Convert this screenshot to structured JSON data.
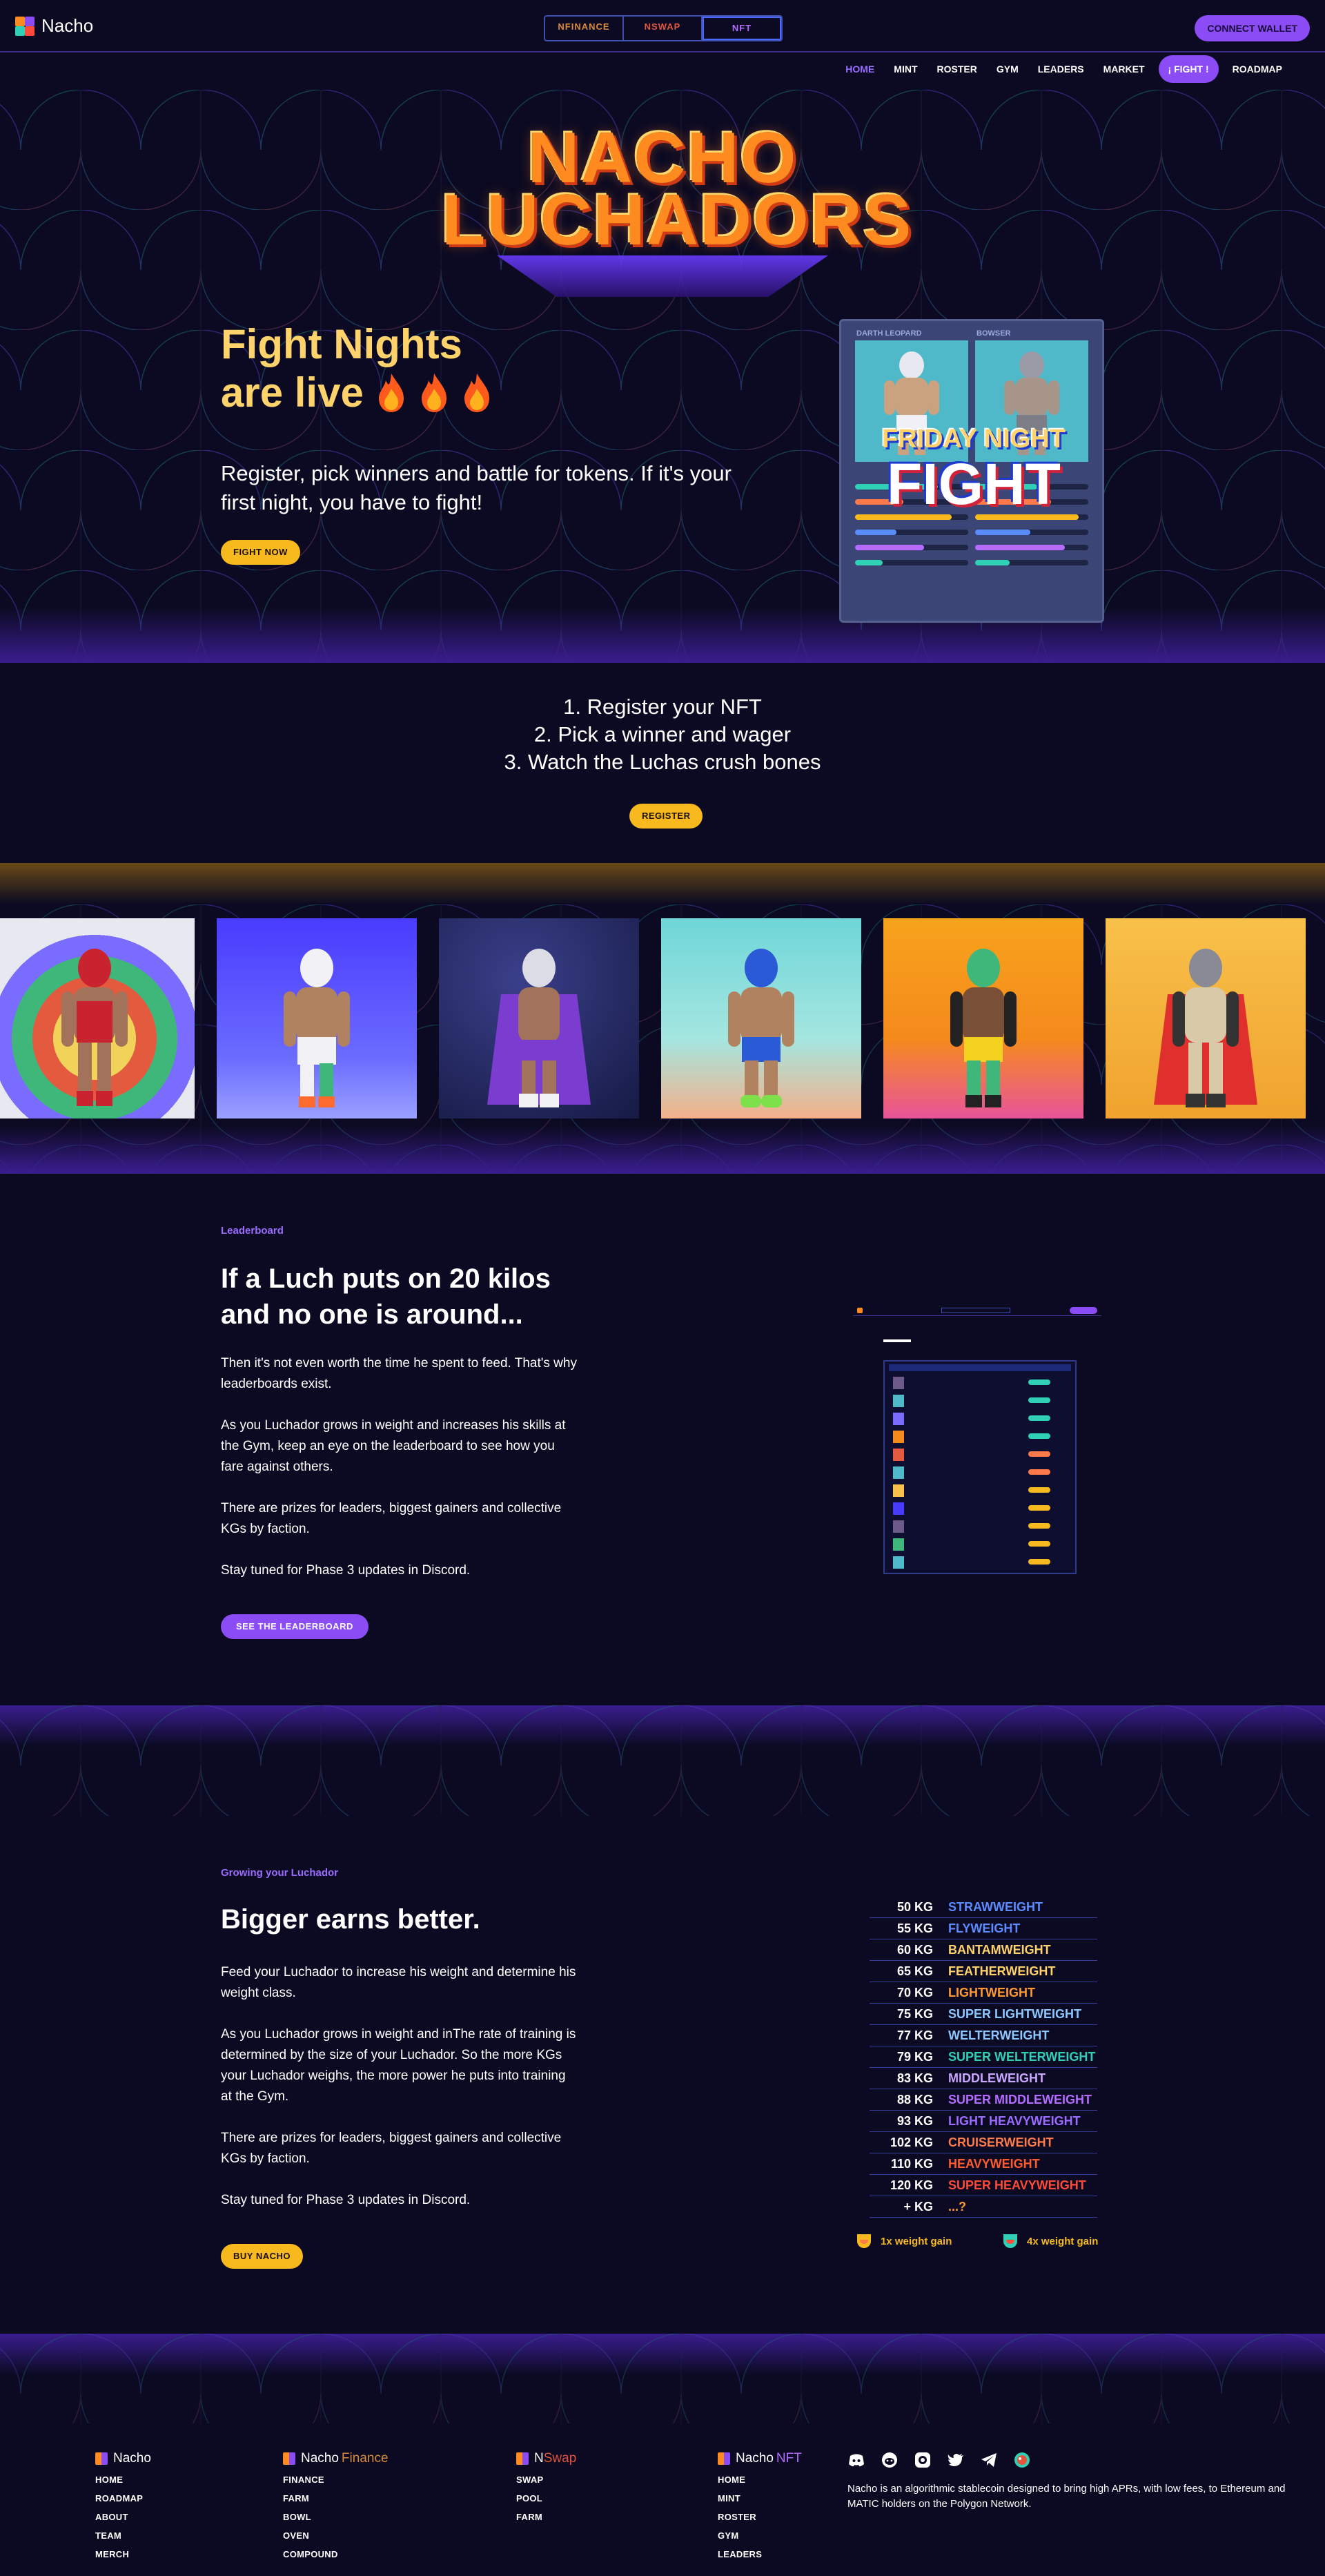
{
  "brand": {
    "name": "Nacho"
  },
  "product_switch": {
    "finance": "NFINANCE",
    "swap": "NSWAP",
    "nft": "NFT"
  },
  "connect_label": "CONNECT WALLET",
  "nav": {
    "items": [
      "HOME",
      "MINT",
      "ROSTER",
      "GYM",
      "LEADERS",
      "MARKET",
      "¡ FIGHT !",
      "ROADMAP"
    ],
    "active": "HOME"
  },
  "hero": {
    "title_line1": "NACHO",
    "title_line2": "LUCHADORS",
    "heading_line1": "Fight Nights",
    "heading_line2": "are live",
    "subtitle": "Register, pick winners and battle for tokens. If it's your first night, you have to fight!",
    "cta": "FIGHT NOW"
  },
  "fight_card": {
    "left_name": "DARTH LEOPARD",
    "right_name": "BOWSER",
    "banner_line1": "FRIDAY NIGHT",
    "banner_line2": "FIGHT"
  },
  "steps": {
    "items": [
      "1. Register your NFT",
      "2. Pick a winner and wager",
      "3. Watch the Luchas crush bones"
    ],
    "cta": "REGISTER"
  },
  "leaderboard": {
    "eyebrow": "Leaderboard",
    "heading_line1": "If a Luch puts on 20 kilos",
    "heading_line2": "and no one is around...",
    "paragraphs": [
      "Then it's not even worth the time he spent to feed. That's why leaderboards exist.",
      "As you Luchador grows in weight and increases his skills at the Gym, keep an eye on the leaderboard to see how you fare against others.",
      "There are prizes for leaders, biggest gainers and collective KGs by faction.",
      "Stay tuned for Phase 3 updates in Discord."
    ],
    "cta": "SEE THE LEADERBOARD"
  },
  "growing": {
    "eyebrow": "Growing your Luchador",
    "heading": "Bigger earns better.",
    "paragraphs": [
      "Feed your Luchador to increase his weight and determine his weight class.",
      "As you Luchador grows in weight and inThe rate of training is determined by the size of your Luchador. So the more KGs your Luchador weighs, the more power he puts into training at the Gym.",
      "There are prizes for leaders, biggest gainers and collective KGs by faction.",
      "Stay tuned for Phase 3 updates in Discord."
    ],
    "cta": "BUY NACHO",
    "weight_classes": [
      {
        "kg": "50 KG",
        "name": "STRAWWEIGHT",
        "color": "#5b8cff"
      },
      {
        "kg": "55 KG",
        "name": "FLYWEIGHT",
        "color": "#5b8cff"
      },
      {
        "kg": "60 KG",
        "name": "BANTAMWEIGHT",
        "color": "#ffd36b"
      },
      {
        "kg": "65 KG",
        "name": "FEATHERWEIGHT",
        "color": "#ffd36b"
      },
      {
        "kg": "70 KG",
        "name": "LIGHTWEIGHT",
        "color": "#ff9b2e"
      },
      {
        "kg": "75 KG",
        "name": "SUPER LIGHTWEIGHT",
        "color": "#8ec7ff"
      },
      {
        "kg": "77 KG",
        "name": "WELTERWEIGHT",
        "color": "#8ec7ff"
      },
      {
        "kg": "79 KG",
        "name": "SUPER WELTERWEIGHT",
        "color": "#2fd0b5"
      },
      {
        "kg": "83 KG",
        "name": "MIDDLEWEIGHT",
        "color": "#c9a6ff"
      },
      {
        "kg": "88 KG",
        "name": "SUPER MIDDLEWEIGHT",
        "color": "#b36cff"
      },
      {
        "kg": "93 KG",
        "name": "LIGHT HEAVYWEIGHT",
        "color": "#9b6cff"
      },
      {
        "kg": "102 KG",
        "name": "CRUISERWEIGHT",
        "color": "#ff7a4a"
      },
      {
        "kg": "110 KG",
        "name": "HEAVYWEIGHT",
        "color": "#ff5a2e"
      },
      {
        "kg": "120 KG",
        "name": "SUPER HEAVYWEIGHT",
        "color": "#ff4a3a"
      },
      {
        "kg": "+ KG",
        "name": "...?",
        "color": "#ff9b2e"
      }
    ],
    "gains": [
      "1x weight gain",
      "4x weight gain"
    ]
  },
  "footer": {
    "columns": [
      {
        "brand": "Nacho",
        "accent": "",
        "links": [
          "HOME",
          "ROADMAP",
          "ABOUT",
          "TEAM",
          "MERCH"
        ]
      },
      {
        "brand": "Nacho",
        "accent": "Finance",
        "links": [
          "FINANCE",
          "FARM",
          "BOWL",
          "OVEN",
          "COMPOUND"
        ]
      },
      {
        "brand": "N",
        "accent": "Swap",
        "links": [
          "SWAP",
          "POOL",
          "FARM"
        ]
      },
      {
        "brand": "Nacho",
        "accent": "NFT",
        "links": [
          "HOME",
          "MINT",
          "ROSTER",
          "GYM",
          "LEADERS"
        ]
      }
    ],
    "social": [
      "discord-icon",
      "reddit-icon",
      "github-icon",
      "twitter-icon",
      "telegram-icon",
      "coingecko-icon"
    ],
    "description": "Nacho is an algorithmic stablecoin designed to bring high APRs, with low fees, to Ethereum and MATIC holders on the Polygon Network."
  }
}
